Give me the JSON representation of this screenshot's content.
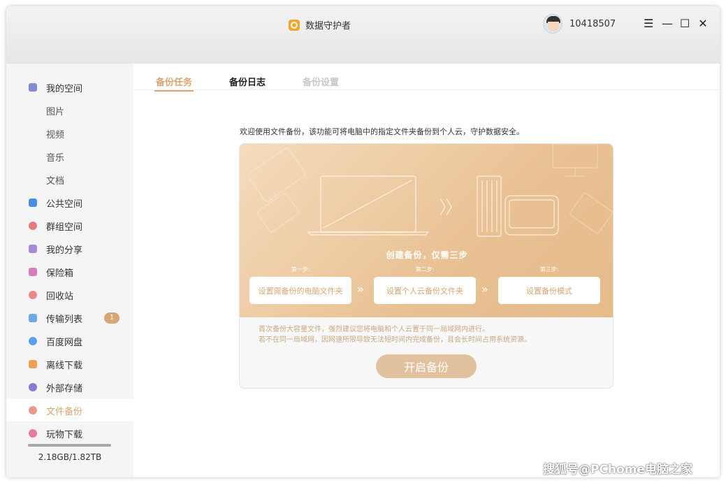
{
  "app": {
    "title": "数据守护者"
  },
  "user": {
    "id": "10418507"
  },
  "window_controls": {
    "menu": "☰",
    "minimize": "—",
    "maximize": "☐",
    "close": "✕"
  },
  "sidebar": {
    "items": [
      {
        "label": "我的空间",
        "icon": "my-space-icon",
        "color": "#7f8bd8"
      },
      {
        "label": "图片"
      },
      {
        "label": "视频"
      },
      {
        "label": "音乐"
      },
      {
        "label": "文档"
      },
      {
        "label": "公共空间",
        "icon": "paper-plane-icon",
        "color": "#4a90e2"
      },
      {
        "label": "群组空间",
        "icon": "group-icon",
        "color": "#e77a7a"
      },
      {
        "label": "我的分享",
        "icon": "share-icon",
        "color": "#a58ad8"
      },
      {
        "label": "保险箱",
        "icon": "safe-icon",
        "color": "#d87bc0"
      },
      {
        "label": "回收站",
        "icon": "trash-icon",
        "color": "#e88a8a"
      },
      {
        "label": "传输列表",
        "icon": "transfer-icon",
        "color": "#6fa9e8",
        "badge": "1"
      },
      {
        "label": "百度网盘",
        "icon": "baidu-cloud-icon",
        "color": "#5aa0f0"
      },
      {
        "label": "离线下载",
        "icon": "download-icon",
        "color": "#f0a050"
      },
      {
        "label": "外部存储",
        "icon": "usb-icon",
        "color": "#8a7ad8"
      },
      {
        "label": "文件备份",
        "icon": "backup-icon",
        "color": "#e89a8a",
        "active": true
      },
      {
        "label": "玩物下载",
        "icon": "wanwu-icon",
        "color": "#e77a9a"
      }
    ],
    "storage": {
      "text": "2.18GB/1.82TB",
      "used_fraction": 1.0
    }
  },
  "tabs": [
    {
      "label": "备份任务",
      "active": true
    },
    {
      "label": "备份日志"
    },
    {
      "label": "备份设置",
      "disabled": true
    }
  ],
  "intro": "欢迎使用文件备份，该功能可将电脑中的指定文件夹备份到个人云，守护数据安全。",
  "hero": {
    "title": "创建备份，仅需三步",
    "steps": [
      {
        "caption": "第一步:",
        "label": "设置需备份的电脑文件夹"
      },
      {
        "caption": "第二步:",
        "label": "设置个人云备份文件夹"
      },
      {
        "caption": "第三步:",
        "label": "设置备份模式"
      }
    ],
    "arrow": "»"
  },
  "notice": [
    "首次备份大容量文件，强烈建议您将电脑和个人云置于同一局域网内进行。",
    "若不在同一局域网，因网速所限导致无法短时间内完成备份，且会长时间占用系统资源。"
  ],
  "start_button": "开启备份",
  "watermark": "搜狐号@PChome电脑之家",
  "colors": {
    "accent": "#d8a574",
    "hero_start": "#f5dcbd",
    "hero_end": "#e6bb8a"
  }
}
